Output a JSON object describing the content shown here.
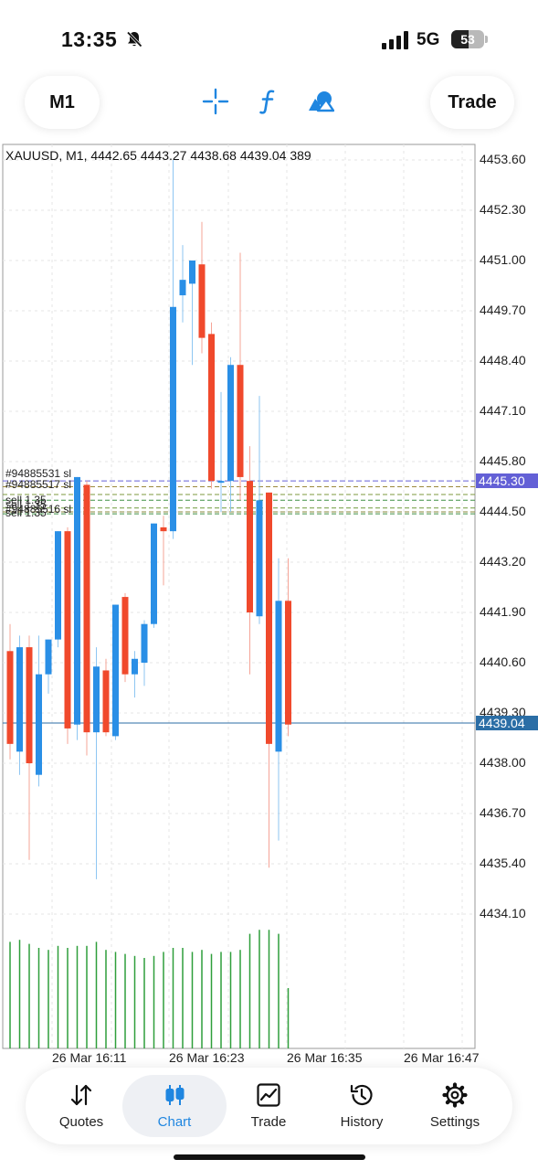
{
  "status_bar": {
    "time": "13:35",
    "network": "5G",
    "battery": "53",
    "battery_level": 0.53
  },
  "toolbar": {
    "timeframe": "M1",
    "trade_label": "Trade",
    "icons": [
      "crosshair-icon",
      "function-icon",
      "objects-icon"
    ],
    "accent": "#1f86e0"
  },
  "chart": {
    "title": "XAUUSD, M1, 4442.65 4443.27 4438.68 4439.04 389",
    "price_labels": [
      "4453.60",
      "4452.30",
      "4451.00",
      "4449.70",
      "4448.40",
      "4447.10",
      "4445.80",
      "4444.50",
      "4443.20",
      "4441.90",
      "4440.60",
      "4439.30",
      "4438.00",
      "4436.70",
      "4435.40",
      "4434.10"
    ],
    "time_labels": [
      "26 Mar 16:11",
      "26 Mar 16:23",
      "26 Mar 16:35",
      "26 Mar 16:47"
    ],
    "upper_line_price": "4445.30",
    "current_price": "4439.04",
    "order_labels": [
      "#94885531 sl",
      "#94885517 sl",
      "sell 1.35",
      "sell 1.35",
      "#94885516 sl",
      "sell 1.35"
    ],
    "colors": {
      "bull": "#2a8fe6",
      "bear": "#f0492c",
      "volume": "#2e9e3a",
      "upper_line": "#6360d6",
      "current_line": "#2b6ea6"
    }
  },
  "chart_data": {
    "type": "candlestick",
    "symbol": "XAUUSD",
    "timeframe": "M1",
    "ohlc_header": {
      "open": 4442.65,
      "high": 4443.27,
      "low": 4438.68,
      "close": 4439.04,
      "volume": 389
    },
    "ylim": [
      4433.0,
      4454.0
    ],
    "candles": [
      {
        "o": 4440.9,
        "h": 4441.6,
        "l": 4438.1,
        "c": 4438.5
      },
      {
        "o": 4438.3,
        "h": 4441.3,
        "l": 4437.7,
        "c": 4441.0
      },
      {
        "o": 4441.0,
        "h": 4441.3,
        "l": 4435.5,
        "c": 4438.0
      },
      {
        "o": 4437.7,
        "h": 4441.3,
        "l": 4437.4,
        "c": 4440.3
      },
      {
        "o": 4440.3,
        "h": 4441.2,
        "l": 4439.8,
        "c": 4441.2
      },
      {
        "o": 4441.2,
        "h": 4444.0,
        "l": 4441.0,
        "c": 4444.0
      },
      {
        "o": 4444.0,
        "h": 4444.1,
        "l": 4438.5,
        "c": 4438.9
      },
      {
        "o": 4439.0,
        "h": 4445.4,
        "l": 4438.6,
        "c": 4445.4
      },
      {
        "o": 4445.2,
        "h": 4445.3,
        "l": 4438.2,
        "c": 4438.8
      },
      {
        "o": 4438.8,
        "h": 4441.0,
        "l": 4435.0,
        "c": 4440.5
      },
      {
        "o": 4440.4,
        "h": 4440.7,
        "l": 4438.7,
        "c": 4438.8
      },
      {
        "o": 4438.7,
        "h": 4442.1,
        "l": 4438.6,
        "c": 4442.1
      },
      {
        "o": 4442.3,
        "h": 4442.4,
        "l": 4440.1,
        "c": 4440.3
      },
      {
        "o": 4440.3,
        "h": 4440.9,
        "l": 4439.7,
        "c": 4440.7
      },
      {
        "o": 4440.6,
        "h": 4441.7,
        "l": 4440.0,
        "c": 4441.6
      },
      {
        "o": 4441.6,
        "h": 4444.2,
        "l": 4441.5,
        "c": 4444.2
      },
      {
        "o": 4444.1,
        "h": 4444.4,
        "l": 4442.6,
        "c": 4444.0
      },
      {
        "o": 4444.0,
        "h": 4453.6,
        "l": 4443.8,
        "c": 4449.8
      },
      {
        "o": 4450.1,
        "h": 4451.4,
        "l": 4449.4,
        "c": 4450.5
      },
      {
        "o": 4450.4,
        "h": 4451.0,
        "l": 4448.3,
        "c": 4451.0
      },
      {
        "o": 4450.9,
        "h": 4452.0,
        "l": 4448.6,
        "c": 4449.0
      },
      {
        "o": 4449.1,
        "h": 4449.4,
        "l": 4445.1,
        "c": 4445.3
      },
      {
        "o": 4445.3,
        "h": 4447.6,
        "l": 4444.5,
        "c": 4445.3
      },
      {
        "o": 4445.3,
        "h": 4448.5,
        "l": 4444.5,
        "c": 4448.3
      },
      {
        "o": 4448.3,
        "h": 4451.2,
        "l": 4444.8,
        "c": 4445.4
      },
      {
        "o": 4445.3,
        "h": 4446.2,
        "l": 4440.3,
        "c": 4441.9
      },
      {
        "o": 4441.8,
        "h": 4447.5,
        "l": 4441.6,
        "c": 4444.8
      },
      {
        "o": 4445.0,
        "h": 4445.0,
        "l": 4435.3,
        "c": 4438.5
      },
      {
        "o": 4438.3,
        "h": 4443.3,
        "l": 4436.0,
        "c": 4442.2
      },
      {
        "o": 4442.2,
        "h": 4443.3,
        "l": 4438.7,
        "c": 4439.0
      }
    ],
    "volume": [
      53,
      54,
      52,
      50,
      49,
      51,
      50,
      51,
      51,
      53,
      49,
      48,
      47,
      46,
      45,
      46,
      48,
      50,
      50,
      48,
      49,
      47,
      48,
      48,
      49,
      57,
      59,
      59,
      57,
      30
    ],
    "upper_line": 4445.3,
    "current_price": 4439.04,
    "order_lines": [
      4445.15,
      4444.95,
      4444.8,
      4444.6,
      4444.5,
      4444.45
    ],
    "x_tick_labels": [
      "26 Mar 16:11",
      "26 Mar 16:23",
      "26 Mar 16:35",
      "26 Mar 16:47"
    ],
    "y_tick_labels": [
      "4453.60",
      "4452.30",
      "4451.00",
      "4449.70",
      "4448.40",
      "4447.10",
      "4445.80",
      "4444.50",
      "4443.20",
      "4441.90",
      "4440.60",
      "4439.30",
      "4438.00",
      "4436.70",
      "4435.40",
      "4434.10"
    ]
  },
  "bottom_nav": [
    {
      "label": "Quotes",
      "icon": "quotes-icon",
      "active": false
    },
    {
      "label": "Chart",
      "icon": "chart-icon",
      "active": true
    },
    {
      "label": "Trade",
      "icon": "trade-icon",
      "active": false
    },
    {
      "label": "History",
      "icon": "history-icon",
      "active": false
    },
    {
      "label": "Settings",
      "icon": "settings-icon",
      "active": false
    }
  ]
}
